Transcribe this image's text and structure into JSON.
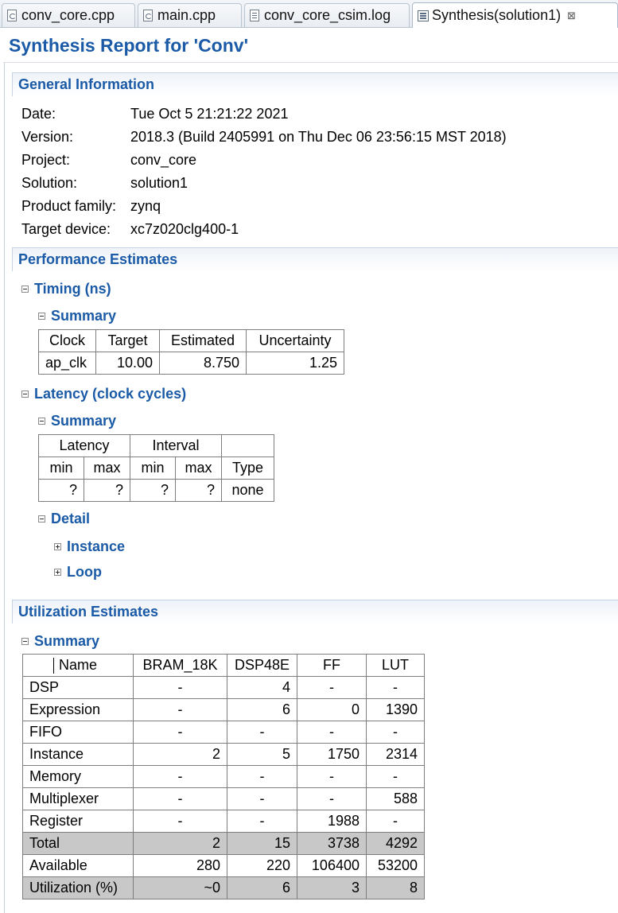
{
  "tabs": [
    {
      "label": "conv_core.cpp",
      "icon": "cpp-file-icon"
    },
    {
      "label": "main.cpp",
      "icon": "cpp-file-icon"
    },
    {
      "label": "conv_core_csim.log",
      "icon": "log-file-icon"
    },
    {
      "label": "Synthesis(solution1)",
      "icon": "report-icon",
      "active": true,
      "close": "⊠"
    }
  ],
  "page_title": "Synthesis Report for 'Conv'",
  "general": {
    "heading": "General Information",
    "rows": [
      {
        "label": "Date:",
        "value": "Tue Oct 5 21:21:22 2021"
      },
      {
        "label": "Version:",
        "value": "2018.3 (Build 2405991 on Thu Dec 06 23:56:15 MST 2018)"
      },
      {
        "label": "Project:",
        "value": "conv_core"
      },
      {
        "label": "Solution:",
        "value": "solution1"
      },
      {
        "label": "Product family:",
        "value": "zynq"
      },
      {
        "label": "Target device:",
        "value": "xc7z020clg400-1"
      }
    ]
  },
  "performance": {
    "heading": "Performance Estimates",
    "timing": {
      "heading": "Timing (ns)",
      "summary": "Summary",
      "headers": [
        "Clock",
        "Target",
        "Estimated",
        "Uncertainty"
      ],
      "row": [
        "ap_clk",
        "10.00",
        "8.750",
        "1.25"
      ]
    },
    "latency": {
      "heading": "Latency (clock cycles)",
      "summary": "Summary",
      "group_headers": [
        "Latency",
        "Interval"
      ],
      "headers": [
        "min",
        "max",
        "min",
        "max",
        "Type"
      ],
      "row": [
        "?",
        "?",
        "?",
        "?",
        "none"
      ],
      "detail": "Detail",
      "instance": "Instance",
      "loop": "Loop"
    }
  },
  "utilization": {
    "heading": "Utilization Estimates",
    "summary": "Summary",
    "headers": [
      "Name",
      "BRAM_18K",
      "DSP48E",
      "FF",
      "LUT"
    ],
    "rows": [
      [
        "DSP",
        "-",
        "4",
        "-",
        "-"
      ],
      [
        "Expression",
        "-",
        "6",
        "0",
        "1390"
      ],
      [
        "FIFO",
        "-",
        "-",
        "-",
        "-"
      ],
      [
        "Instance",
        "2",
        "5",
        "1750",
        "2314"
      ],
      [
        "Memory",
        "-",
        "-",
        "-",
        "-"
      ],
      [
        "Multiplexer",
        "-",
        "-",
        "-",
        "588"
      ],
      [
        "Register",
        "-",
        "-",
        "1988",
        "-"
      ],
      [
        "Total",
        "2",
        "15",
        "3738",
        "4292"
      ],
      [
        "Available",
        "280",
        "220",
        "106400",
        "53200"
      ],
      [
        "Utilization (%)",
        "~0",
        "6",
        "3",
        "8"
      ]
    ]
  }
}
